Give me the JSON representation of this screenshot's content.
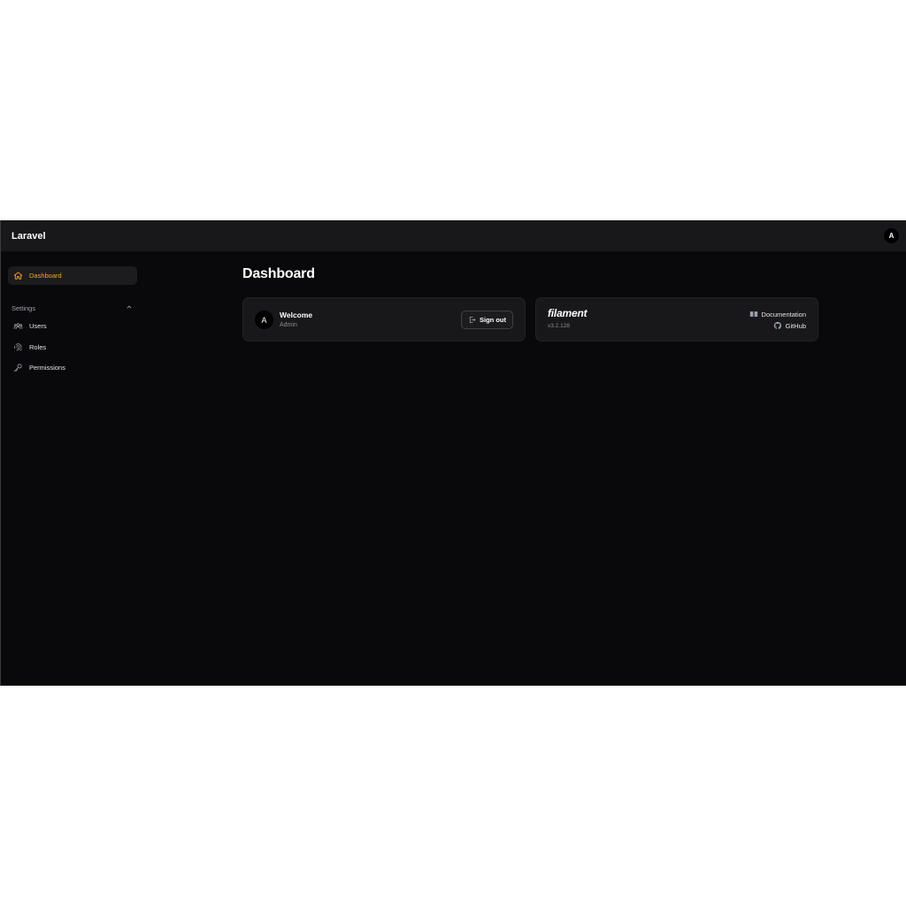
{
  "topbar": {
    "brand": "Laravel",
    "user_initial": "A"
  },
  "sidebar": {
    "dashboard": {
      "label": "Dashboard",
      "icon": "home-icon"
    },
    "settings_group": {
      "label": "Settings",
      "items": [
        {
          "label": "Users",
          "icon": "users-icon"
        },
        {
          "label": "Roles",
          "icon": "fingerprint-icon"
        },
        {
          "label": "Permissions",
          "icon": "key-icon"
        }
      ]
    }
  },
  "main": {
    "title": "Dashboard",
    "welcome": {
      "avatar_initial": "A",
      "title": "Welcome",
      "subtitle": "Admin",
      "signout_label": "Sign out"
    },
    "filament": {
      "logo": "filament",
      "version": "v3.2.128",
      "docs_label": "Documentation",
      "github_label": "GitHub"
    }
  },
  "colors": {
    "accent": "#f5a524",
    "background": "#09090b",
    "surface": "#18181b"
  }
}
